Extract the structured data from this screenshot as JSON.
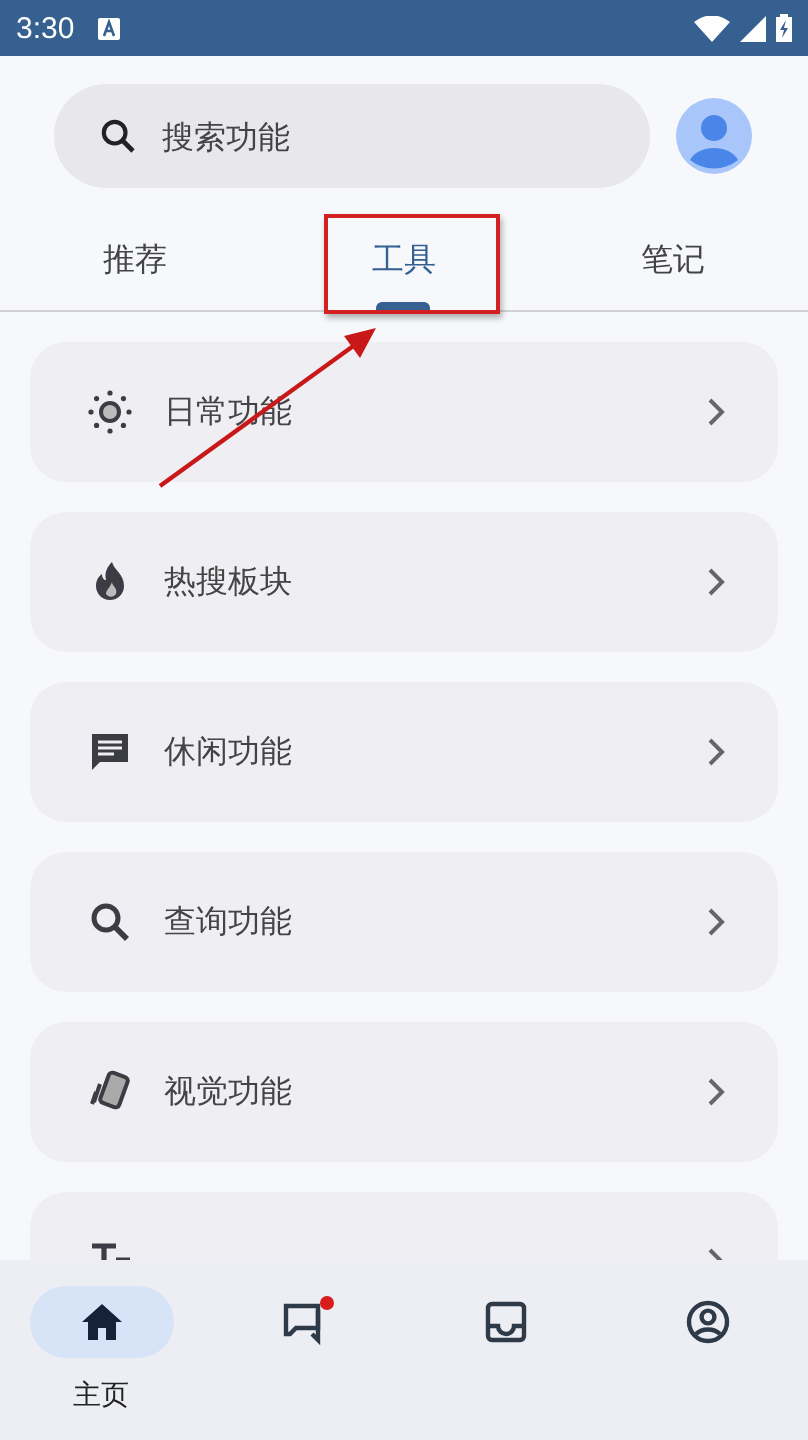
{
  "status_bar": {
    "time": "3:30"
  },
  "search": {
    "placeholder": "搜索功能"
  },
  "tabs": [
    {
      "label": "推荐",
      "selected": false
    },
    {
      "label": "工具",
      "selected": true
    },
    {
      "label": "笔记",
      "selected": false
    }
  ],
  "items": [
    {
      "kind": "sun",
      "label": "日常功能"
    },
    {
      "kind": "fire",
      "label": "热搜板块"
    },
    {
      "kind": "chat",
      "label": "休闲功能"
    },
    {
      "kind": "search",
      "label": "查询功能"
    },
    {
      "kind": "cards",
      "label": "视觉功能"
    },
    {
      "kind": "text"
    }
  ],
  "nav": [
    {
      "kind": "home",
      "label": "主页",
      "selected": true,
      "badge": false
    },
    {
      "kind": "messages",
      "selected": false,
      "badge": true
    },
    {
      "kind": "inbox",
      "selected": false,
      "badge": false
    },
    {
      "kind": "profile",
      "selected": false,
      "badge": false
    }
  ]
}
